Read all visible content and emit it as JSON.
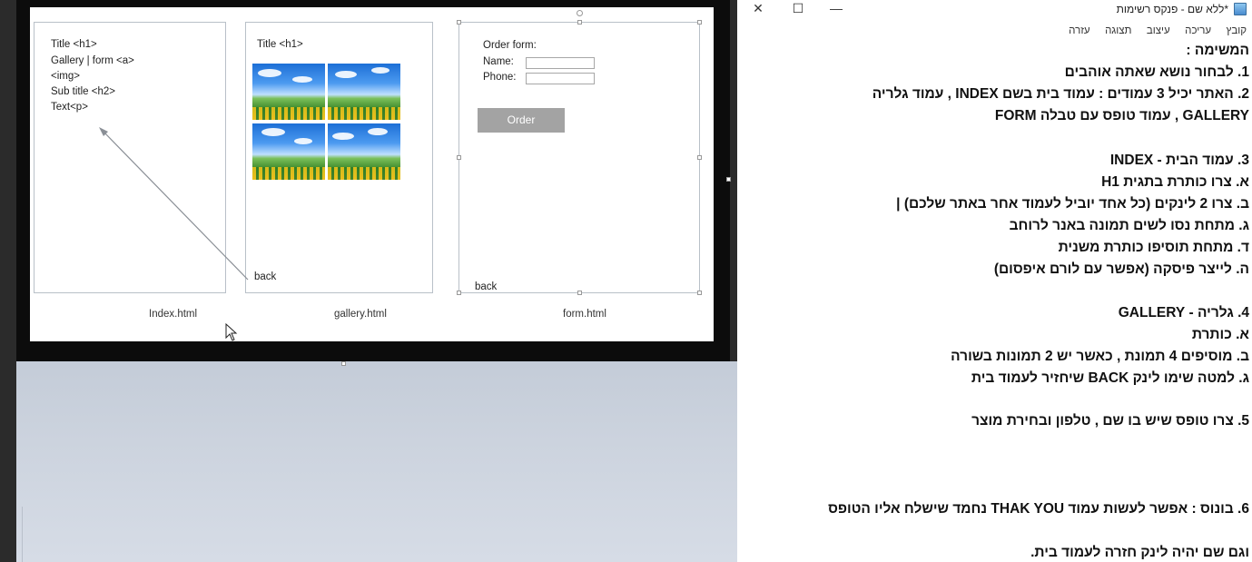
{
  "slide": {
    "index_panel": {
      "lines": [
        "Title <h1>",
        "Gallery | form <a>",
        "<img>",
        "Sub title <h2>",
        "Text<p>"
      ]
    },
    "gallery_panel": {
      "title": "Title <h1>",
      "back": "back"
    },
    "form_panel": {
      "title": "Order form:",
      "name_label": "Name:",
      "phone_label": "Phone:",
      "order_button": "Order",
      "back": "back"
    },
    "captions": {
      "index": "Index.html",
      "gallery": "gallery.html",
      "form": "form.html"
    }
  },
  "notepad": {
    "title": "*ללא שם - פנקס רשימות",
    "menu": [
      "קובץ",
      "עריכה",
      "עיצוב",
      "תצוגה",
      "עזרה"
    ],
    "window_controls": {
      "close": "✕",
      "maximize": "☐",
      "minimize": "—"
    },
    "lines": [
      "המשימה :",
      "1. לבחור נושא שאתה אוהבים",
      "2. האתר יכיל 3 עמודים : עמוד בית בשם INDEX , עמוד גלריה",
      "GALLERY , עמוד טופס עם טבלה FORM",
      "3. עמוד הבית - INDEX",
      "א. צרו כותרת בתגית H1",
      "ב. צרו 2 לינקים (כל אחד יוביל לעמוד אחר באתר שלכם) |",
      "ג. מתחת נסו לשים תמונה באנר לרוחב",
      "ד. מתחת תוסיפו כותרת משנית",
      "ה. לייצר פיסקה (אפשר עם לורם איפסום)",
      "4. גלריה - GALLERY",
      "א. כותרת",
      "ב. מוסיפים 4 תמונת , כאשר יש 2 תמונות בשורה",
      "ג. למטה שימו לינק BACK שיחזיר לעמוד בית",
      "5. צרו   טופס שיש בו שם , טלפון ובחירת מוצר",
      "6. בונוס : אפשר לעשות עמוד THAK YOU נחמד שישלח אליו הטופס",
      "וגם שם יהיה לינק חזרה לעמוד בית."
    ]
  },
  "colors": {
    "order_button": "#a3a3a3",
    "slide_border": "#0c0c0c",
    "lower_bg": "#ccd3de"
  }
}
